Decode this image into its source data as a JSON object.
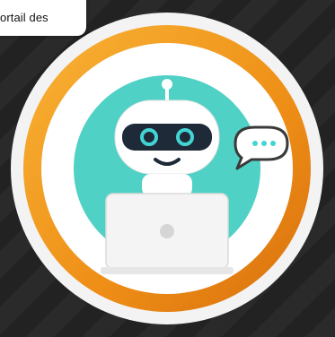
{
  "header": {
    "text": "ortail des"
  },
  "badge": {
    "icon": "robot-with-laptop-and-chat-bubble",
    "colors": {
      "ring_outer": "#f5a21c",
      "ring_inner": "#e67e12",
      "disc": "#4fd1c5",
      "robot": "#ffffff",
      "visor": "#1e2a38",
      "eyes": "#43d4d4",
      "chat_bubble": "#3a3a3a"
    }
  }
}
